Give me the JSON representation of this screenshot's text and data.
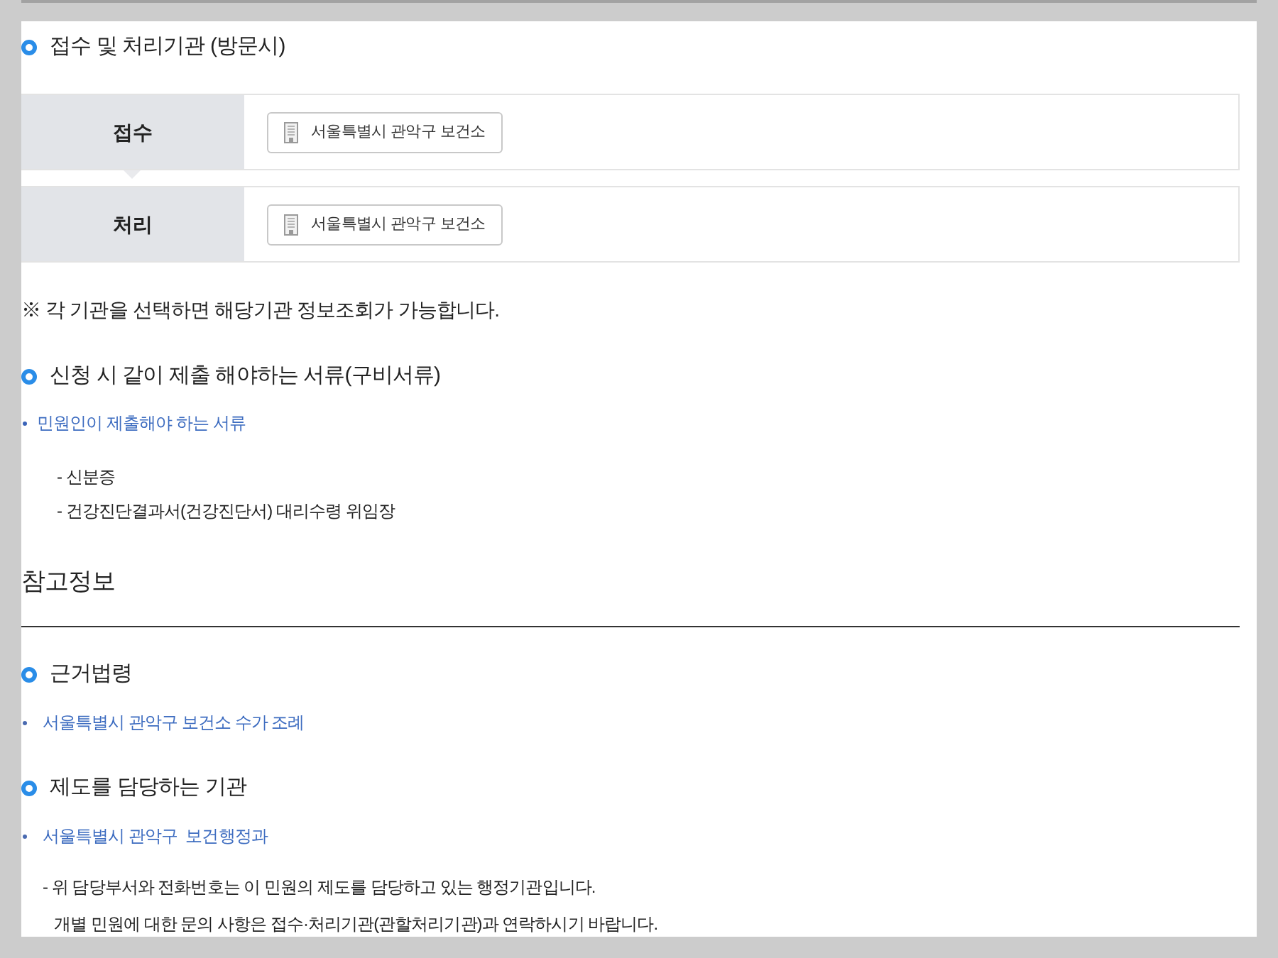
{
  "agency_section": {
    "heading": "접수 및 처리기관 (방문시)",
    "rows": [
      {
        "label": "접수",
        "agency": "서울특별시 관악구 보건소"
      },
      {
        "label": "처리",
        "agency": "서울특별시 관악구 보건소"
      }
    ],
    "note": "※ 각 기관을 선택하면 해당기관 정보조회가 가능합니다."
  },
  "documents_section": {
    "heading": "신청 시 같이 제출 해야하는 서류(구비서류)",
    "items": [
      {
        "text": "민원인이 제출해야 하는 서류",
        "children": [
          {
            "text": "- 신분증"
          },
          {
            "text": "- 건강진단결과서(건강진단서) 대리수령 위임장"
          }
        ]
      }
    ]
  },
  "reference": {
    "title": "참고정보",
    "sections": [
      {
        "heading": "근거법령",
        "links": [
          "서울특별시 관악구 보건소 수가 조례"
        ]
      },
      {
        "heading": "제도를 담당하는 기관",
        "links": [
          "서울특별시 관악구  보건행정과"
        ],
        "notes": [
          "- 위 담당부서와 전화번호는 이 민원의 제도를 담당하고 있는 행정기관입니다.",
          "개별 민원에 대한 문의 사항은 접수·처리기관(관할처리기관)과 연락하시기 바랍니다."
        ]
      }
    ]
  }
}
